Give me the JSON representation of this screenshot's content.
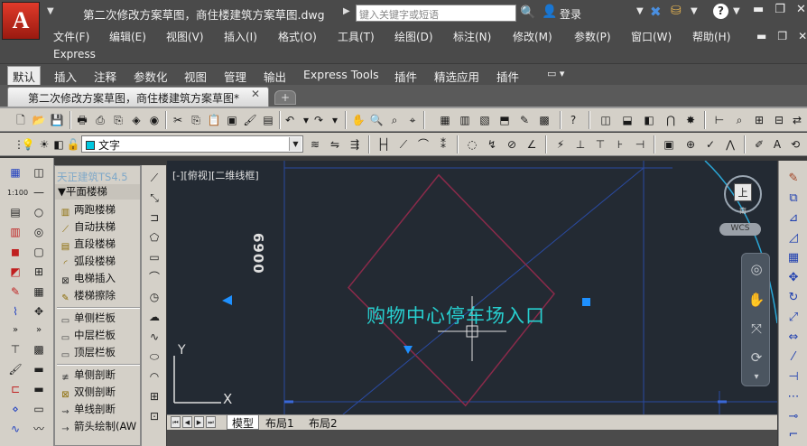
{
  "app": {
    "logo_letter": "A",
    "window_title": "第二次修改方案草图，商住楼建筑方案草图.dwg",
    "search_placeholder": "键入关键字或短语",
    "login_label": "登录",
    "help_label": "?"
  },
  "menu": {
    "items": [
      "文件(F)",
      "编辑(E)",
      "视图(V)",
      "插入(I)",
      "格式(O)",
      "工具(T)",
      "绘图(D)",
      "标注(N)",
      "修改(M)",
      "参数(P)",
      "窗口(W)",
      "帮助(H)"
    ],
    "second_line": "Express"
  },
  "ribbon": {
    "tabs": [
      "默认",
      "插入",
      "注释",
      "参数化",
      "视图",
      "管理",
      "输出",
      "Express Tools",
      "插件",
      "精选应用",
      "插件"
    ]
  },
  "file_tab": {
    "label": "第二次修改方案草图，商住楼建筑方案草图*",
    "close_label": "✕"
  },
  "layer": {
    "current": "文字",
    "swatch_color": "#00c8e0"
  },
  "tz_panel": {
    "title": "天正建筑TS4.5",
    "section": "▼平面楼梯",
    "items": [
      "两跑楼梯",
      "自动扶梯",
      "直段楼梯",
      "弧段楼梯",
      "电梯插入",
      "楼梯擦除",
      "单侧栏板",
      "中层栏板",
      "顶层栏板",
      "单侧剖断",
      "双侧剖断",
      "单线剖断",
      "箭头绘制(AW"
    ]
  },
  "canvas": {
    "viewport_label": "[-][俯视][二维线框]",
    "dimension_text": "6900",
    "main_text": "购物中心停车场入口",
    "ucs_y": "Y",
    "ucs_x": "X",
    "viewcube_top": "上",
    "viewcube_south": "南",
    "wcs_label": "WCS",
    "background_color": "#232a33",
    "text_color": "#27d0d0"
  },
  "layout_tabs": {
    "tabs": [
      "模型",
      "布局1",
      "布局2"
    ],
    "active": "模型"
  }
}
